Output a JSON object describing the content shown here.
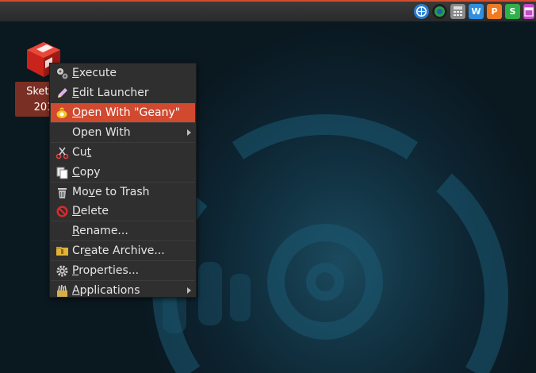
{
  "desktop_icon": {
    "label_line1": "Sketch",
    "label_line2": "201",
    "icon": "sketchup-icon"
  },
  "tray": [
    {
      "name": "network-globe-icon",
      "text": "",
      "color": "#2a7fd4"
    },
    {
      "name": "browser-icon",
      "text": "",
      "color": "#1f1f1f"
    },
    {
      "name": "calculator-icon",
      "text": "",
      "color": "#8a8a8a"
    },
    {
      "name": "wps-writer-icon",
      "text": "W",
      "color": "#2d8fe0"
    },
    {
      "name": "wps-presentation-icon",
      "text": "P",
      "color": "#f07a22"
    },
    {
      "name": "wps-spreadsheet-icon",
      "text": "S",
      "color": "#2fb04a"
    },
    {
      "name": "window-icon",
      "text": "",
      "color": "#c54ac9"
    }
  ],
  "menu": {
    "items": [
      {
        "id": "execute",
        "pre": "",
        "u": "E",
        "post": "xecute",
        "icon": "gears-icon",
        "submenu": false,
        "active": false
      },
      {
        "id": "edit-launcher",
        "pre": "",
        "u": "E",
        "post": "dit Launcher",
        "icon": "pencil-icon",
        "submenu": false,
        "active": false
      },
      {
        "id": "open-with-geany",
        "pre": "",
        "u": "O",
        "post": "pen With \"Geany\"",
        "icon": "geany-icon",
        "submenu": false,
        "active": true
      },
      {
        "id": "open-with",
        "pre": "Open With",
        "u": "",
        "post": "",
        "icon": "",
        "submenu": true,
        "active": false
      },
      {
        "id": "cut",
        "pre": "Cu",
        "u": "t",
        "post": "",
        "icon": "scissors-icon",
        "submenu": false,
        "active": false
      },
      {
        "id": "copy",
        "pre": "",
        "u": "C",
        "post": "opy",
        "icon": "copy-icon",
        "submenu": false,
        "active": false
      },
      {
        "id": "move-to-trash",
        "pre": "Mo",
        "u": "v",
        "post": "e to Trash",
        "icon": "trash-icon",
        "submenu": false,
        "active": false
      },
      {
        "id": "delete",
        "pre": "",
        "u": "D",
        "post": "elete",
        "icon": "delete-icon",
        "submenu": false,
        "active": false
      },
      {
        "id": "rename",
        "pre": "",
        "u": "R",
        "post": "ename...",
        "icon": "",
        "submenu": false,
        "active": false
      },
      {
        "id": "create-archive",
        "pre": "Cr",
        "u": "e",
        "post": "ate Archive...",
        "icon": "archive-icon",
        "submenu": false,
        "active": false
      },
      {
        "id": "properties",
        "pre": "",
        "u": "P",
        "post": "roperties...",
        "icon": "gear-icon",
        "submenu": false,
        "active": false
      },
      {
        "id": "applications",
        "pre": "",
        "u": "A",
        "post": "pplications",
        "icon": "applications-icon",
        "submenu": true,
        "active": false
      }
    ]
  }
}
